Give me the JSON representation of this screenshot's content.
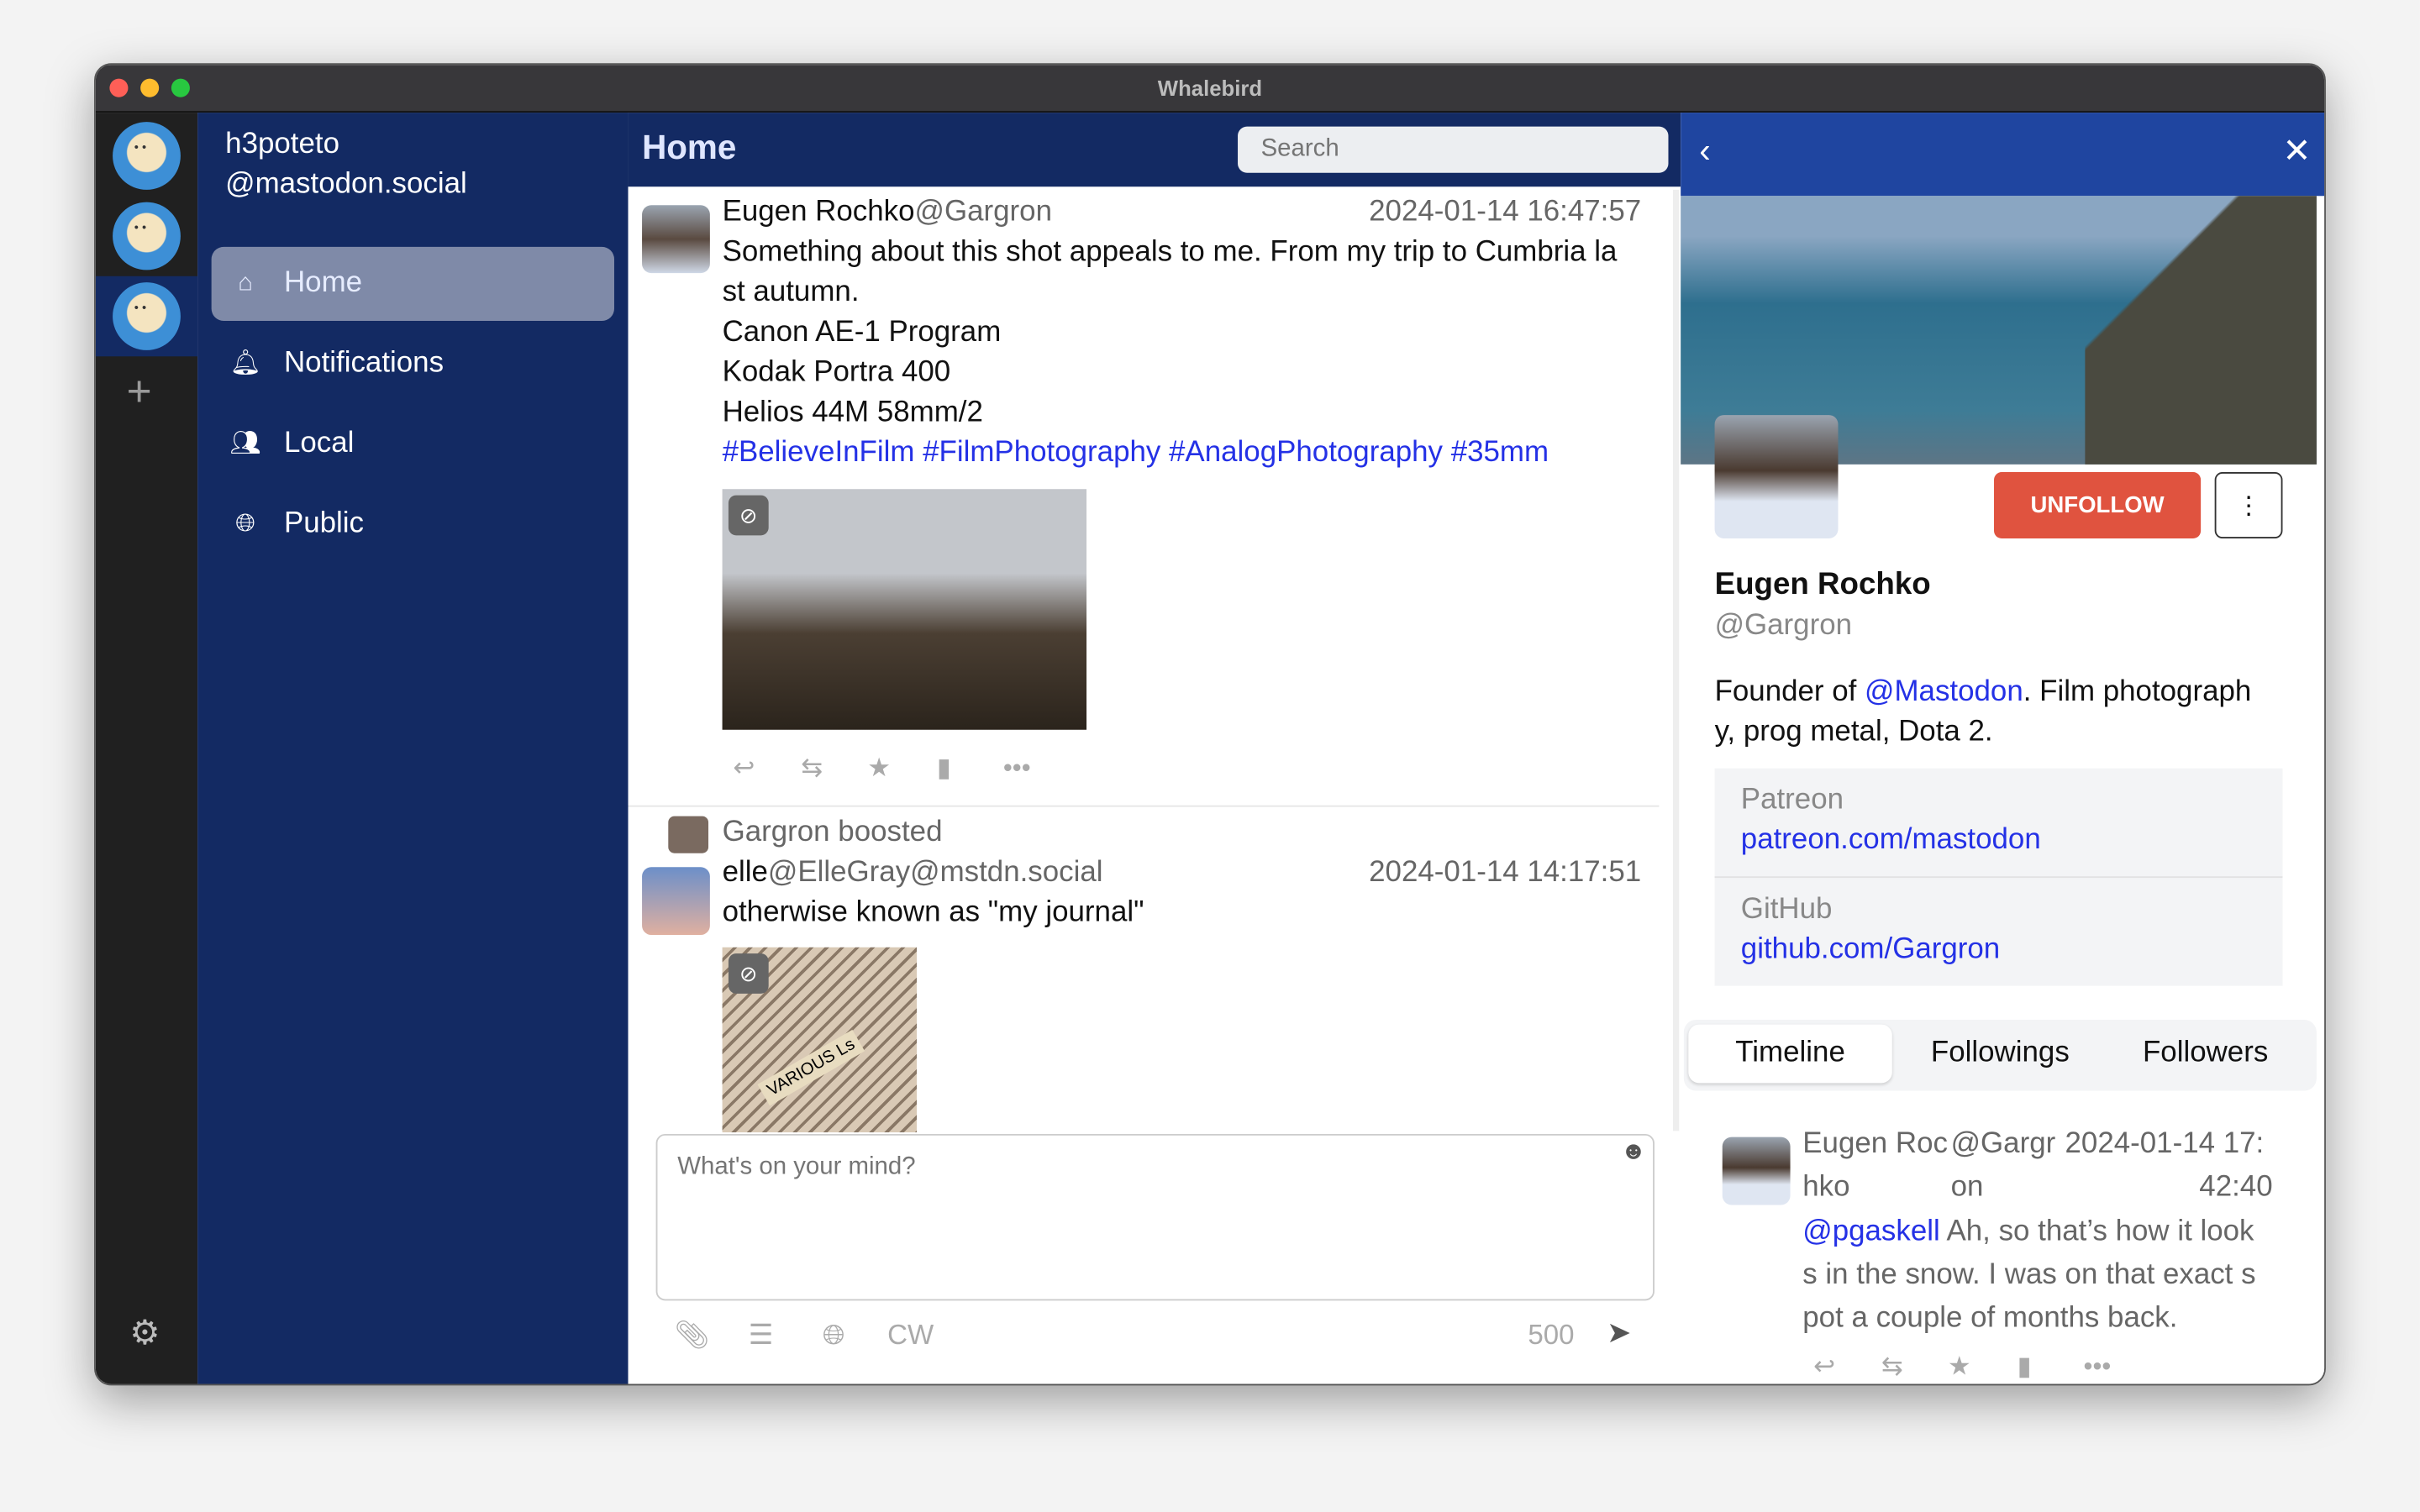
{
  "window": {
    "title": "Whalebird"
  },
  "account": {
    "username": "h3poteto",
    "domain": "@mastodon.social"
  },
  "sidebar": {
    "items": [
      {
        "label": "Home",
        "icon": "home-icon",
        "active": true
      },
      {
        "label": "Notifications",
        "icon": "bell-icon"
      },
      {
        "label": "Local",
        "icon": "users-icon"
      },
      {
        "label": "Public",
        "icon": "globe-icon"
      }
    ]
  },
  "header": {
    "title": "Home",
    "search_placeholder": "Search"
  },
  "posts": [
    {
      "display_name": "Eugen Rochko",
      "acct": "@Gargron",
      "time": "2024-01-14 16:47:57",
      "lines": [
        "Something about this shot appeals to me. From my trip to Cumbria la",
        "st autumn.",
        "Canon AE-1 Program",
        "Kodak Portra 400",
        "Helios 44M 58mm/2"
      ],
      "hashtags": "#BelieveInFilm #FilmPhotography #AnalogPhotography #35mm"
    },
    {
      "boosted_by": "Gargron boosted",
      "display_name": "elle",
      "acct": "@ElleGray@mstdn.social",
      "time": "2024-01-14 14:17:51",
      "lines": [
        "otherwise known as \"my journal\""
      ],
      "image_label": "VARIOUS Ls"
    }
  ],
  "compose": {
    "placeholder": "What's on your mind?",
    "cw": "CW",
    "remaining": "500"
  },
  "profile": {
    "display_name": "Eugen Rochko",
    "acct": "@Gargron",
    "unfollow": "UNFOLLOW",
    "more": "⋮",
    "bio_prefix": "Founder of ",
    "bio_mention": "@Mastodon",
    "bio_line1": ". Film photograph",
    "bio_line2": "y, prog metal, Dota 2.",
    "fields": [
      {
        "name": "Patreon",
        "value": "patreon.com/mastodon"
      },
      {
        "name": "GitHub",
        "value": "github.com/Gargron"
      }
    ],
    "tabs": [
      {
        "label": "Timeline",
        "active": true
      },
      {
        "label": "Followings"
      },
      {
        "label": "Followers"
      }
    ],
    "post": {
      "name1": "Eugen Roc",
      "name2": "hko",
      "acct1": "@Gargr",
      "acct2": "on",
      "time1": "2024-01-14 17:",
      "time2": "42:40",
      "mention": "@pgaskell",
      "line1": " Ah, so that’s how it look",
      "line2": "s in the snow. I was on that exact s",
      "line3": "pot a couple of months back."
    }
  },
  "colors": {
    "navy": "#132a63",
    "accent": "#1f45a0",
    "unfollow": "#e0533f",
    "link": "#2431e6"
  }
}
